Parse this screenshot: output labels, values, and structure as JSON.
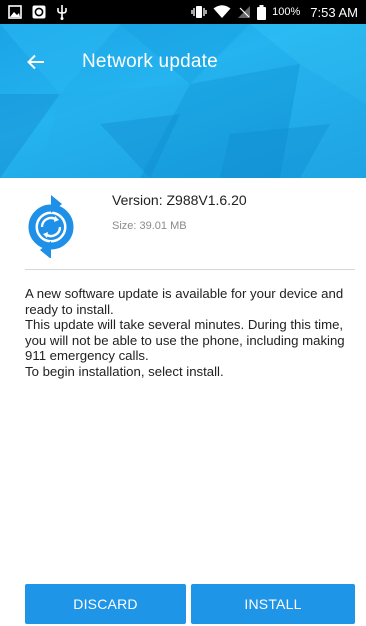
{
  "status_bar": {
    "left_icons": [
      "gallery-icon",
      "sync-icon",
      "usb-icon"
    ],
    "right_icons": [
      "vibrate-icon",
      "wifi-icon",
      "no-signal-icon",
      "battery-icon"
    ],
    "battery": "100%",
    "time": "7:53 AM"
  },
  "app_bar": {
    "title": "Network update",
    "back_icon": "arrow-left-icon",
    "color": "#1aa3e6"
  },
  "update": {
    "icon": "refresh-icon",
    "version": "Version: Z988V1.6.20",
    "size": "Size: 39.01 MB"
  },
  "description": {
    "line1": "A new software update is available for your device and ready to install.",
    "line2": "This update will take several minutes. During this time, you will not be able to use the phone, including making 911 emergency calls.",
    "line3": "To begin installation, select install."
  },
  "buttons": {
    "discard": "DISCARD",
    "install": "INSTALL",
    "color": "#1e95e6"
  }
}
